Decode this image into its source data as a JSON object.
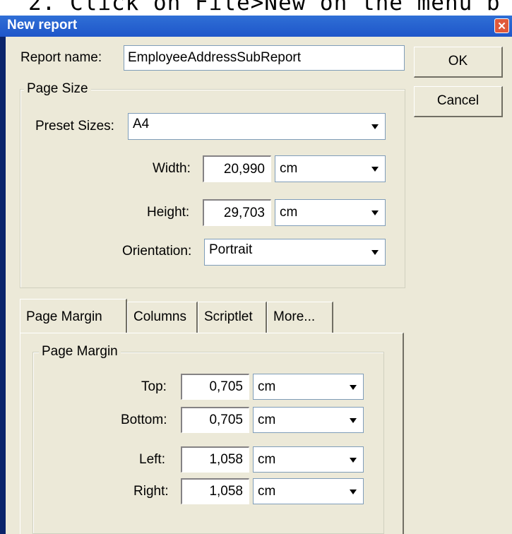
{
  "background_text": "2. Click on File>New on the menu b",
  "window": {
    "title": "New report"
  },
  "report_name": {
    "label": "Report name:",
    "value": "EmployeeAddressSubReport"
  },
  "buttons": {
    "ok": "OK",
    "cancel": "Cancel"
  },
  "page_size": {
    "legend": "Page Size",
    "preset_label": "Preset Sizes:",
    "preset_value": "A4",
    "width_label": "Width:",
    "width_value": "20,990",
    "width_unit": "cm",
    "height_label": "Height:",
    "height_value": "29,703",
    "height_unit": "cm",
    "orientation_label": "Orientation:",
    "orientation_value": "Portrait"
  },
  "tabs": [
    {
      "label": "Page Margin",
      "selected": true
    },
    {
      "label": "Columns",
      "selected": false
    },
    {
      "label": "Scriptlet",
      "selected": false
    },
    {
      "label": "More...",
      "selected": false
    }
  ],
  "page_margin": {
    "legend": "Page Margin",
    "top_label": "Top:",
    "top_value": "0,705",
    "top_unit": "cm",
    "bottom_label": "Bottom:",
    "bottom_value": "0,705",
    "bottom_unit": "cm",
    "left_label": "Left:",
    "left_value": "1,058",
    "left_unit": "cm",
    "right_label": "Right:",
    "right_value": "1,058",
    "right_unit": "cm"
  },
  "colors": {
    "titlebar": "#1f56c9",
    "dialog_bg": "#ece9d8",
    "close": "#e0593a"
  }
}
